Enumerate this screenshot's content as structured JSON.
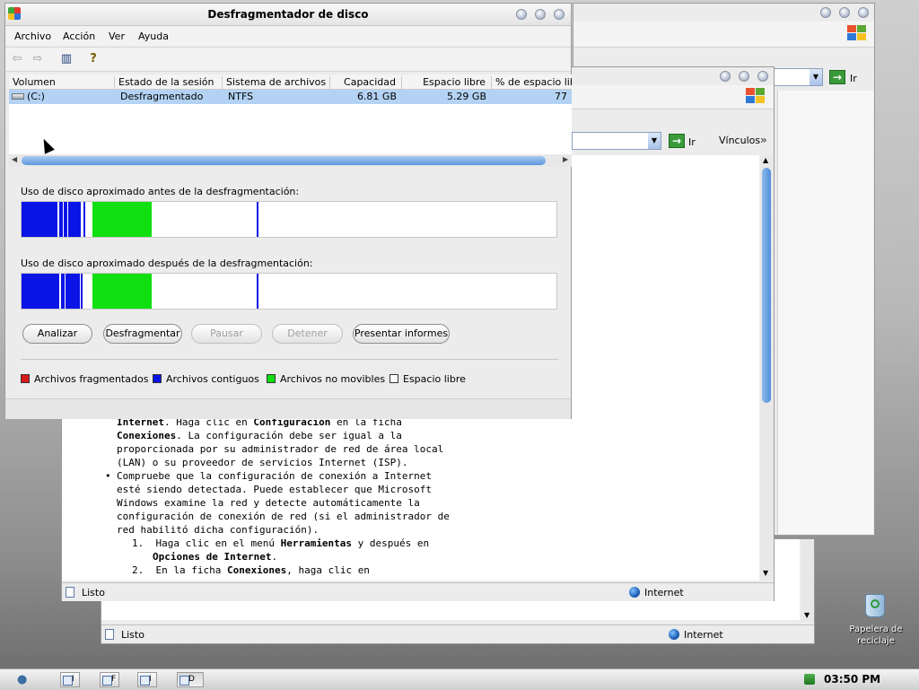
{
  "defrag": {
    "title": "Desfragmentador de disco",
    "menu": [
      "Archivo",
      "Acción",
      "Ver",
      "Ayuda"
    ],
    "columns": [
      "Volumen",
      "Estado de la sesión",
      "Sistema de archivos",
      "Capacidad",
      "Espacio libre",
      "% de espacio libr"
    ],
    "rows": [
      {
        "volume": "(C:)",
        "status": "Desfragmentado",
        "fs": "NTFS",
        "capacity": "6.81 GB",
        "free": "5.29 GB",
        "pct": "77"
      }
    ],
    "before_label": "Uso de disco aproximado antes de la desfragmentación:",
    "after_label": "Uso de disco aproximado después de la desfragmentación:",
    "buttons": {
      "analyze": "Analizar",
      "defrag": "Desfragmentar",
      "pause": "Pausar",
      "stop": "Detener",
      "reports": "Presentar informes"
    },
    "legend": {
      "fragmented": "Archivos fragmentados",
      "contiguous": "Archivos contiguos",
      "unmovable": "Archivos no movibles",
      "free": "Espacio libre"
    },
    "colors": {
      "fragmented": "#d81818",
      "contiguous": "#0a14e6",
      "unmovable": "#10e010",
      "free": "#ffffff"
    }
  },
  "ie_front": {
    "go_label": "Ir",
    "links_label": "Vínculos",
    "content": {
      "line1_bold_a": "Internet",
      "line1_text": ". Haga clic en ",
      "line1_bold_b": "Configuración",
      "line1_tail": " en la ficha",
      "line2_bold": "Conexiones",
      "line2_text": ". La configuración debe ser igual a la",
      "line3": "proporcionada por su administrador de red de área local",
      "line4": "(LAN) o su proveedor de servicios Internet (ISP).",
      "bullet_lines": [
        "Compruebe que la configuración de conexión a Internet",
        "esté siendo detectada. Puede establecer que Microsoft",
        "Windows examine la red y detecte automáticamente la",
        "configuración de conexión de red (si el administrador de",
        "red habilitó dicha configuración)."
      ],
      "step1_num": "1.",
      "step1_text": "Haga clic en el menú ",
      "step1_bold": "Herramientas",
      "step1_tail": " y después en",
      "step1_line2_bold": "Opciones de Internet",
      "step1_line2_tail": ".",
      "step2_num": "2.",
      "step2_text": "En la ficha ",
      "step2_bold": "Conexiones",
      "step2_tail": ", haga clic en"
    },
    "status_left": "Listo",
    "status_right": "Internet"
  },
  "ie_back": {
    "go_label": "Ir",
    "status_left": "Listo",
    "status_right": "Internet"
  },
  "desktop": {
    "recycle_label_1": "Papelera de",
    "recycle_label_2": "reciclaje"
  },
  "taskbar": {
    "tasks": [
      "I",
      "F",
      "I",
      "D"
    ],
    "clock": "03:50 PM"
  }
}
